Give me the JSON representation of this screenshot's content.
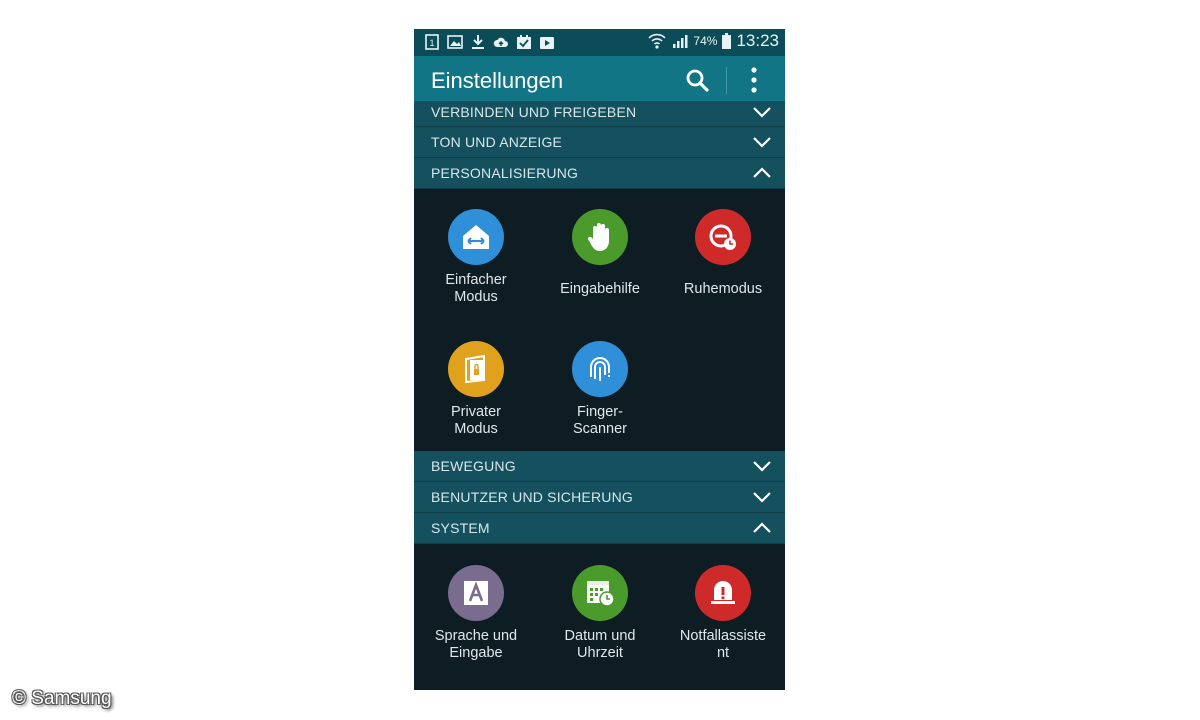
{
  "status_bar": {
    "battery": "74%",
    "time": "13:23",
    "left_icons": [
      "sim-icon",
      "gallery-icon",
      "download-icon",
      "cloud-upload-icon",
      "calendar-check-icon",
      "play-store-icon"
    ],
    "right_icons": [
      "wifi-icon",
      "signal-icon",
      "battery-icon"
    ]
  },
  "action_bar": {
    "title": "Einstellungen",
    "icons": [
      "search-icon",
      "overflow-menu-icon"
    ]
  },
  "sections": {
    "verbinden": {
      "label": "VERBINDEN UND FREIGEBEN",
      "state": "collapsed"
    },
    "ton": {
      "label": "TON UND ANZEIGE",
      "state": "collapsed"
    },
    "personalisierung": {
      "label": "PERSONALISIERUNG",
      "state": "expanded"
    },
    "bewegung": {
      "label": "BEWEGUNG",
      "state": "collapsed"
    },
    "benutzer": {
      "label": "BENUTZER UND SICHERUNG",
      "state": "collapsed"
    },
    "system": {
      "label": "SYSTEM",
      "state": "expanded"
    }
  },
  "personalisierung_items": {
    "einfacher_modus": {
      "line1": "Einfacher",
      "line2": "Modus",
      "color": "#2f8fd8",
      "icon": "easy-mode-icon"
    },
    "eingabehilfe": {
      "line1": "Eingabehilfe",
      "line2": "",
      "color": "#4b9a2c",
      "icon": "hand-icon"
    },
    "ruhemodus": {
      "line1": "Ruhemodus",
      "line2": "",
      "color": "#cf2a2a",
      "icon": "blocking-clock-icon"
    },
    "privater_modus": {
      "line1": "Privater",
      "line2": "Modus",
      "color": "#e0a21c",
      "icon": "private-lock-icon"
    },
    "finger_scanner": {
      "line1": "Finger-",
      "line2": "Scanner",
      "color": "#2f8fd8",
      "icon": "fingerprint-icon"
    }
  },
  "system_items": {
    "sprache": {
      "line1": "Sprache und",
      "line2": "Eingabe",
      "color": "#7a6c8e",
      "icon": "language-a-icon"
    },
    "datum": {
      "line1": "Datum und",
      "line2": "Uhrzeit",
      "color": "#4b9a2c",
      "icon": "calendar-clock-icon"
    },
    "notfall": {
      "line1": "Notfallassiste",
      "line2": "nt",
      "color": "#cf2a2a",
      "icon": "emergency-alert-icon"
    }
  },
  "watermark": "© Samsung",
  "colors": {
    "status_bar": "#0b4c58",
    "action_bar": "#127585",
    "section_header": "#14505d",
    "content_bg": "#0e1d24"
  }
}
